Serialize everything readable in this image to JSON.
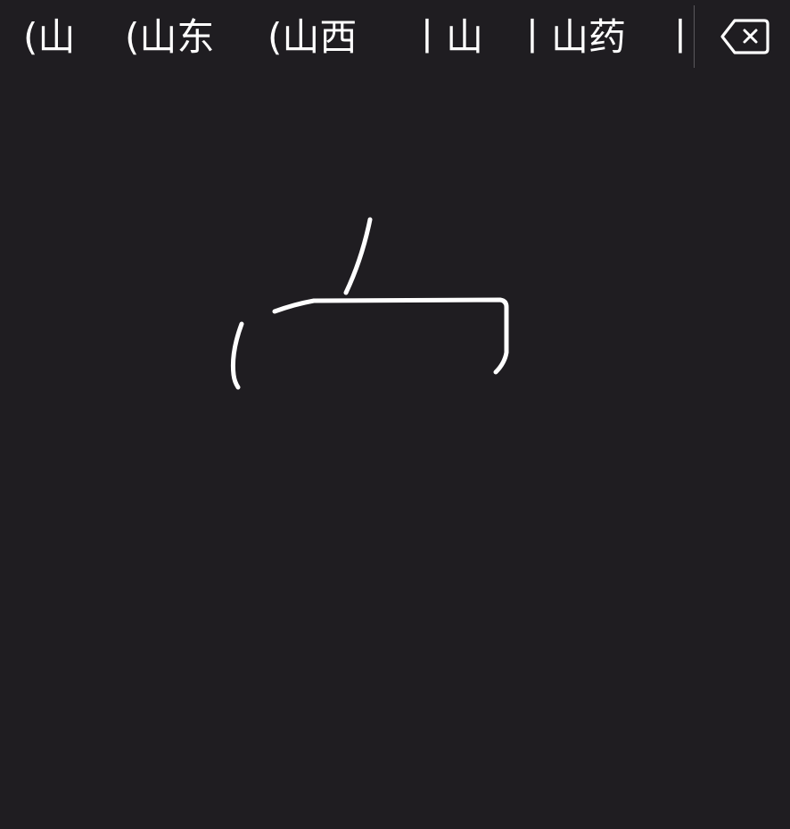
{
  "candidates": [
    {
      "text": "(山"
    },
    {
      "text": "(山东"
    },
    {
      "text": "(山西"
    },
    {
      "text": "丨山"
    },
    {
      "text": "丨山药"
    },
    {
      "text": "丨山"
    }
  ],
  "toolbar": {
    "delete_icon": "backspace-icon"
  },
  "colors": {
    "background": "#1f1d21",
    "ink": "#ffffff",
    "text": "#ffffff"
  }
}
